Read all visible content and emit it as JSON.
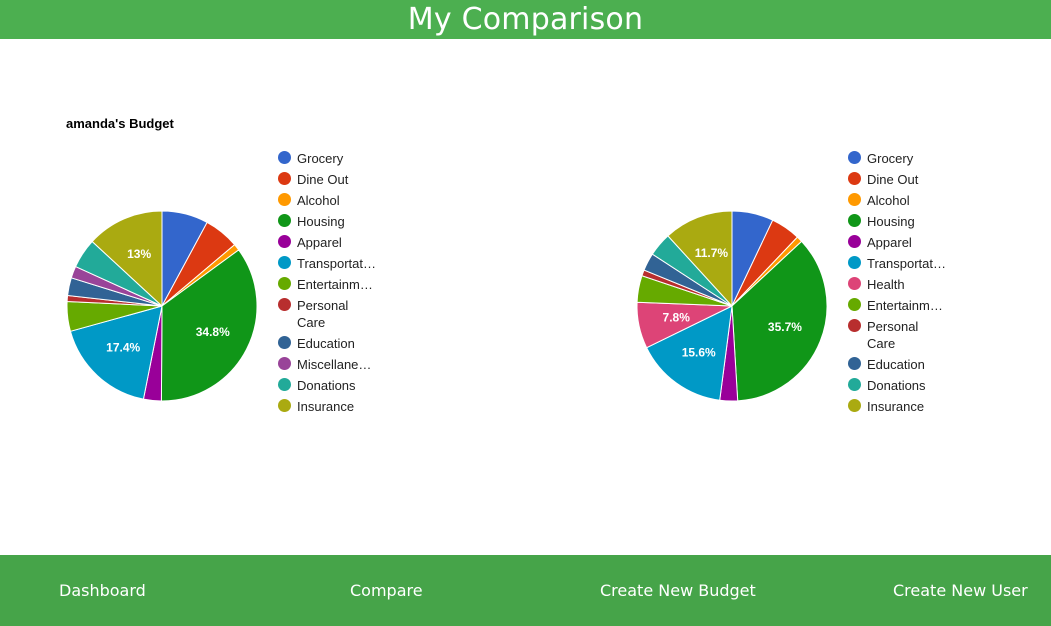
{
  "header": {
    "title": "My Comparison"
  },
  "charts": [
    {
      "title": "amanda's Budget",
      "chart_data": {
        "type": "pie",
        "title": "amanda's Budget",
        "slices": [
          {
            "label": "Grocery",
            "value": 7.8,
            "color": "#3366cc"
          },
          {
            "label": "Dine Out",
            "value": 5.9,
            "color": "#dc3912"
          },
          {
            "label": "Alcohol",
            "value": 1.1,
            "color": "#ff9900"
          },
          {
            "label": "Housing",
            "value": 34.8,
            "color": "#109618",
            "display": "34.8%"
          },
          {
            "label": "Apparel",
            "value": 3.0,
            "color": "#990099"
          },
          {
            "label": "Transportat…",
            "value": 17.4,
            "color": "#0099c6",
            "display": "17.4%"
          },
          {
            "label": "Entertainm…",
            "value": 5.0,
            "color": "#66aa00"
          },
          {
            "label": "Personal\nCare",
            "value": 1.0,
            "color": "#b82e2e"
          },
          {
            "label": "Education",
            "value": 3.0,
            "color": "#316395"
          },
          {
            "label": "Miscellane…",
            "value": 2.0,
            "color": "#994499"
          },
          {
            "label": "Donations",
            "value": 5.0,
            "color": "#22aa99"
          },
          {
            "label": "Insurance",
            "value": 13.0,
            "color": "#aaaa11",
            "display": "13%"
          }
        ]
      }
    },
    {
      "title": "",
      "chart_data": {
        "type": "pie",
        "title": "",
        "slices": [
          {
            "label": "Grocery",
            "value": 7.0,
            "color": "#3366cc"
          },
          {
            "label": "Dine Out",
            "value": 5.0,
            "color": "#dc3912"
          },
          {
            "label": "Alcohol",
            "value": 1.0,
            "color": "#ff9900"
          },
          {
            "label": "Housing",
            "value": 35.7,
            "color": "#109618",
            "display": "35.7%"
          },
          {
            "label": "Apparel",
            "value": 3.0,
            "color": "#990099"
          },
          {
            "label": "Transportat…",
            "value": 15.6,
            "color": "#0099c6",
            "display": "15.6%"
          },
          {
            "label": "Health",
            "value": 7.8,
            "color": "#dd4477",
            "display": "7.8%"
          },
          {
            "label": "Entertainm…",
            "value": 4.5,
            "color": "#66aa00"
          },
          {
            "label": "Personal\nCare",
            "value": 1.0,
            "color": "#b82e2e"
          },
          {
            "label": "Education",
            "value": 3.0,
            "color": "#316395"
          },
          {
            "label": "Donations",
            "value": 4.0,
            "color": "#22aa99"
          },
          {
            "label": "Insurance",
            "value": 11.7,
            "color": "#aaaa11",
            "display": "11.7%"
          }
        ]
      }
    }
  ],
  "nav": {
    "dashboard": "Dashboard",
    "compare": "Compare",
    "create_budget": "Create New Budget",
    "create_user": "Create New User"
  }
}
